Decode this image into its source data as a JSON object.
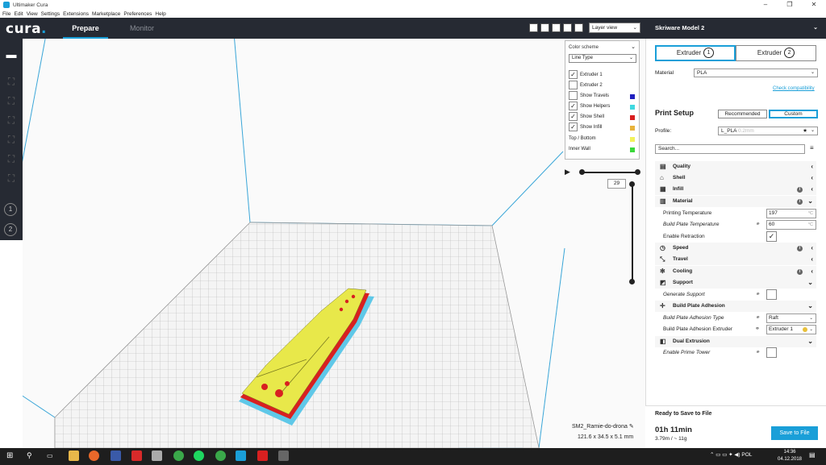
{
  "window": {
    "title": "Ultimaker Cura",
    "controls": [
      "–",
      "❐",
      "✕"
    ]
  },
  "menu": [
    "File",
    "Edit",
    "View",
    "Settings",
    "Extensions",
    "Marketplace",
    "Preferences",
    "Help"
  ],
  "header": {
    "logo": "cura",
    "tabs": [
      "Prepare",
      "Monitor"
    ]
  },
  "view": {
    "mode": "Layer view"
  },
  "color_scheme": {
    "label": "Color scheme",
    "selected": "Line Type",
    "items": [
      {
        "label": "Extruder 1",
        "checked": true,
        "color": ""
      },
      {
        "label": "Extruder 2",
        "checked": false,
        "color": ""
      },
      {
        "label": "Show Travels",
        "checked": false,
        "color": "#1f1fbf"
      },
      {
        "label": "Show Helpers",
        "checked": true,
        "color": "#3fd8e0"
      },
      {
        "label": "Show Shell",
        "checked": true,
        "color": "#d81e1e"
      },
      {
        "label": "Show Infill",
        "checked": true,
        "color": "#e8b23a"
      }
    ],
    "legend": [
      {
        "label": "Top / Bottom",
        "color": "#f2f25a"
      },
      {
        "label": "Inner Wall",
        "color": "#3ad83a"
      }
    ]
  },
  "layer": {
    "current": "29"
  },
  "model": {
    "name": "SM2_Ramie-do-drona",
    "dimensions": "121.6 x 34.5 x 5.1 mm"
  },
  "sidebar": {
    "printer": "Skriware Model 2",
    "extruders": [
      "Extruder",
      "Extruder"
    ],
    "extruder_nums": [
      "1",
      "2"
    ],
    "material_label": "Material",
    "material": "PLA",
    "check_compat": "Check compatibility",
    "print_setup": "Print Setup",
    "modes": [
      "Recommended",
      "Custom"
    ],
    "profile_label": "Profile:",
    "profile": "L_PLA",
    "profile_sub": "0.2mm",
    "search_placeholder": "Search...",
    "categories": {
      "quality": "Quality",
      "shell": "Shell",
      "infill": "Infill",
      "material": "Material",
      "speed": "Speed",
      "travel": "Travel",
      "cooling": "Cooling",
      "support": "Support",
      "adhesion": "Build Plate Adhesion",
      "dual": "Dual Extrusion"
    },
    "settings": {
      "print_temp_label": "Printing Temperature",
      "print_temp": "197",
      "bed_temp_label": "Build Plate Temperature",
      "bed_temp": "60",
      "unit": "°C",
      "retraction_label": "Enable Retraction",
      "gen_support_label": "Generate Support",
      "adhesion_type_label": "Build Plate Adhesion Type",
      "adhesion_type": "Raft",
      "adhesion_extruder_label": "Build Plate Adhesion Extruder",
      "adhesion_extruder": "Extruder 1",
      "prime_tower_label": "Enable Prime Tower"
    },
    "footer": {
      "status": "Ready to Save to File",
      "time": "01h 11min",
      "material": "3.79m / ~ 11g",
      "save": "Save to File"
    }
  },
  "taskbar": {
    "lang": "POL",
    "time": "14:36",
    "date": "04.12.2018"
  }
}
